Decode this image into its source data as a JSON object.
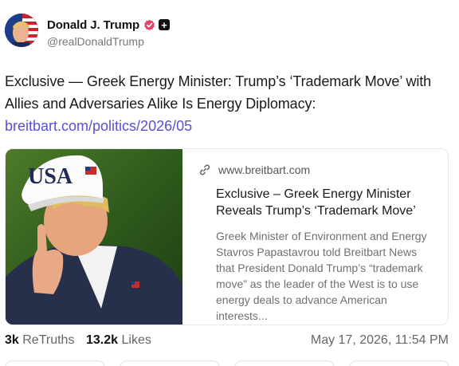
{
  "post": {
    "author": {
      "display_name": "Donald J. Trump",
      "handle": "@realDonaldTrump",
      "verified_color": "#e2456c"
    },
    "text": "Exclusive — Greek Energy Minister: Trump’s ‘Trademark Move’ with Allies and Adversaries Alike Is Energy Diplomacy:",
    "link": "breitbart.com/politics/2026/05",
    "link_color": "#5b4fd1",
    "card": {
      "domain": "www.breitbart.com",
      "title": "Exclusive – Greek Energy Minister Reveals Trump’s ‘Trademark Move’",
      "description": "Greek Minister of Environment and Energy Stavros Papastavrou told Breitbart News that President Donald Trump’s “trademark move” as the leader of the West is to use energy deals to advance American interests...",
      "image_icon": "photo-trump-usa-cap"
    },
    "stats": {
      "retruths_count": "3k",
      "retruths_label": "ReTruths",
      "likes_count": "13.2k",
      "likes_label": "Likes",
      "timestamp": "May 17, 2026, 11:54 PM"
    }
  }
}
